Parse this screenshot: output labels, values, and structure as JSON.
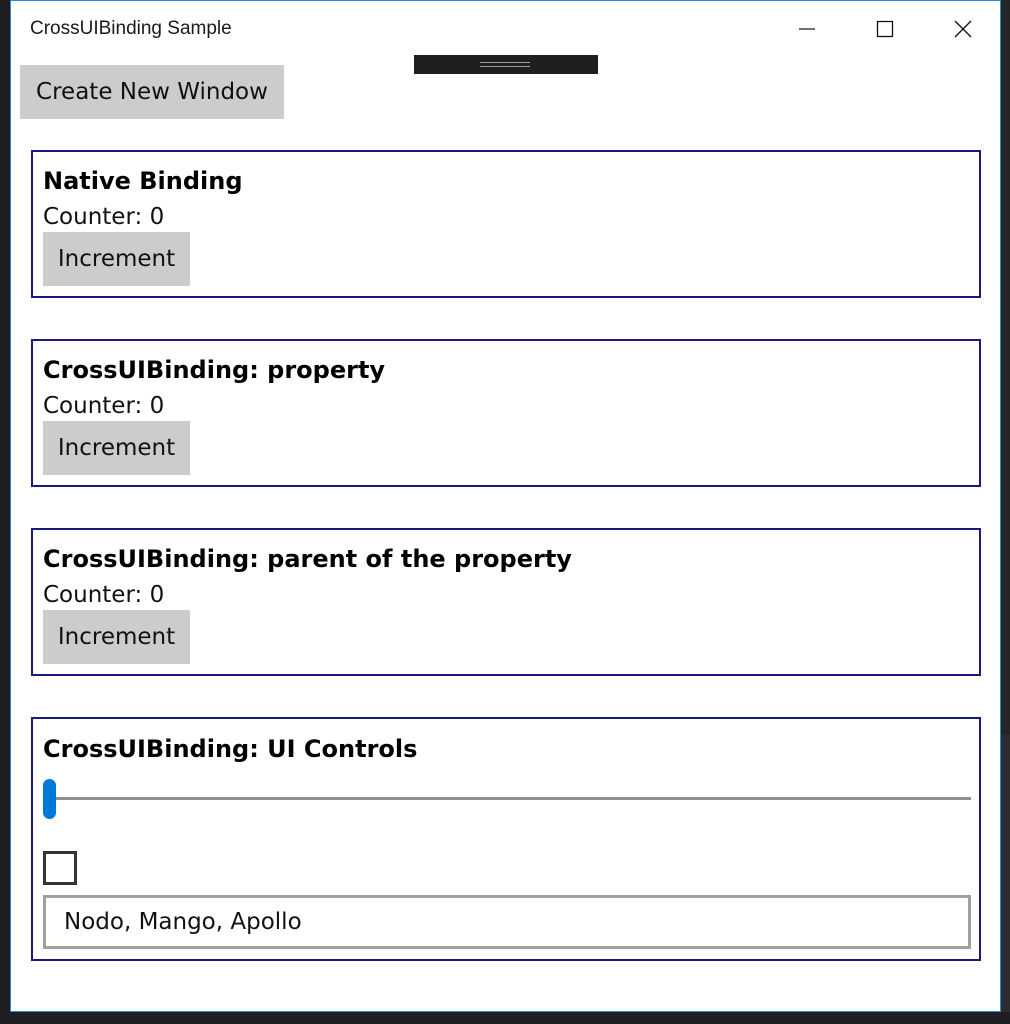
{
  "window": {
    "title": "CrossUIBinding Sample"
  },
  "toolbar": {
    "create_window_label": "Create New Window"
  },
  "panels": [
    {
      "title": "Native Binding",
      "counter": "Counter: 0",
      "button": "Increment"
    },
    {
      "title": "CrossUIBinding: property",
      "counter": "Counter: 0",
      "button": "Increment"
    },
    {
      "title": "CrossUIBinding: parent of the property",
      "counter": "Counter: 0",
      "button": "Increment"
    }
  ],
  "controls": {
    "title": "CrossUIBinding: UI Controls",
    "slider_value": 0,
    "checkbox_checked": false,
    "textbox_value": "Nodo, Mango, Apollo"
  },
  "colors": {
    "panel_border": "#1a1a7a",
    "button_bg": "#cccccc",
    "accent": "#0078d7",
    "window_border": "#2a8ad4"
  },
  "icons": {
    "minimize": "minimize-icon",
    "maximize": "maximize-icon",
    "close": "close-icon"
  }
}
